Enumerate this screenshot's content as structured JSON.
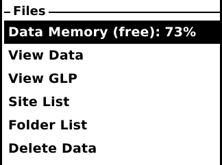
{
  "section": {
    "title": "Files"
  },
  "menu": {
    "items": [
      {
        "label": "Data Memory (free):",
        "value": "73%"
      },
      {
        "label": "View Data"
      },
      {
        "label": "View GLP"
      },
      {
        "label": "Site List"
      },
      {
        "label": "Folder List"
      },
      {
        "label": "Delete Data"
      }
    ],
    "selected_index": 0
  },
  "colors": {
    "background": "#ffffff",
    "foreground": "#000000",
    "highlight_bg": "#000000",
    "highlight_fg": "#ffffff"
  }
}
